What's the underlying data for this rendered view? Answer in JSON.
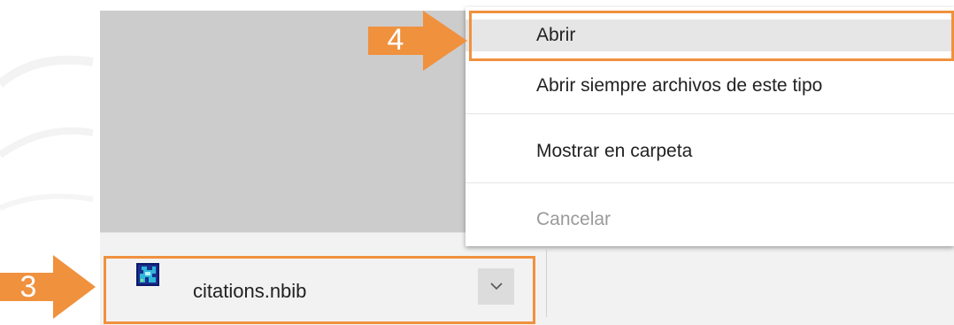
{
  "download_shelf": {
    "file_name": "citations.nbib",
    "file_icon": "nbib-file-icon",
    "chevron_icon": "chevron-down-icon"
  },
  "context_menu": {
    "items": [
      {
        "label": "Abrir",
        "highlighted": true,
        "enabled": true
      },
      {
        "label": "Abrir siempre archivos de este tipo",
        "enabled": true
      },
      {
        "label": "Mostrar en carpeta",
        "enabled": true
      },
      {
        "label": "Cancelar",
        "enabled": false
      }
    ]
  },
  "annotations": {
    "step_download": "3",
    "step_open": "4"
  },
  "colors": {
    "annotation_orange": "#f0913e",
    "content_gray": "#cccccc",
    "shelf_bg": "#f2f2f2",
    "menu_highlight": "#e6e6e6",
    "disabled_text": "#9a9a9a"
  }
}
